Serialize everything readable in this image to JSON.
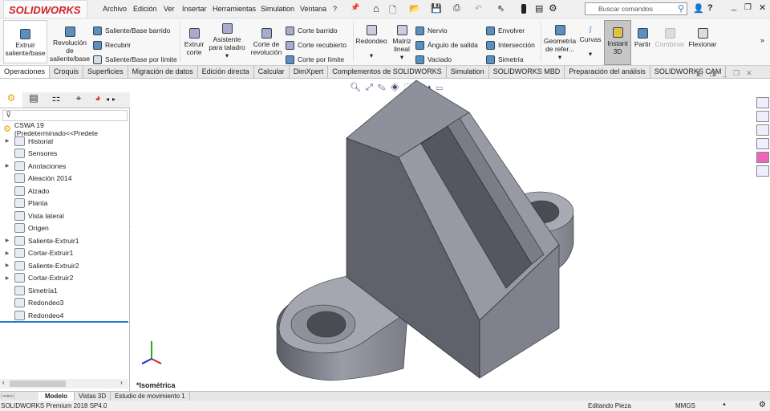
{
  "app": {
    "brand": "SOLIDWORKS"
  },
  "menu": [
    "Archivo",
    "Edición",
    "Ver",
    "Insertar",
    "Herramientas",
    "Simulation",
    "Ventana",
    "?"
  ],
  "search": {
    "placeholder": "Buscar comandos"
  },
  "ribbon": {
    "extrude": "Extruir saliente/base",
    "revolve": "Revolución de saliente/base",
    "sweep": "Saliente/Base barrido",
    "loft": "Recubrir",
    "boundary": "Saliente/Base por límite",
    "cut_extrude": "Extruir corte",
    "hole": "Asistente para taladro",
    "cut_revolve": "Corte de revolución",
    "cut_sweep": "Corte barrido",
    "cut_loft": "Corte recubierto",
    "cut_boundary": "Corte por límite",
    "fillet": "Redondeo",
    "pattern": "Matriz lineal",
    "rib": "Nervio",
    "draft": "Ángulo de salida",
    "shell": "Vaciado",
    "wrap": "Envolver",
    "intersect": "Intersección",
    "mirror": "Simetría",
    "refgeom": "Geometría de refer...",
    "curves": "Curvas",
    "instant3d": "Instant 3D",
    "split": "Partir",
    "combine": "Combinar",
    "flex": "Flexionar"
  },
  "tabs": [
    "Operaciones",
    "Croquis",
    "Superficies",
    "Migración de datos",
    "Edición directa",
    "Calcular",
    "DimXpert",
    "Complementos de SOLIDWORKS",
    "Simulation",
    "SOLIDWORKS MBD",
    "Preparación del análisis",
    "SOLIDWORKS CAM"
  ],
  "tree": {
    "root": "CSWA 19  (Predeterminado<<Predete",
    "items": [
      {
        "label": "Historial",
        "exp": true
      },
      {
        "label": "Sensores",
        "exp": false
      },
      {
        "label": "Anotaciones",
        "exp": true
      },
      {
        "label": "Aleación 2014",
        "exp": false
      },
      {
        "label": "Alzado",
        "exp": false
      },
      {
        "label": "Planta",
        "exp": false
      },
      {
        "label": "Vista lateral",
        "exp": false
      },
      {
        "label": "Origen",
        "exp": false
      },
      {
        "label": "Saliente-Extruir1",
        "exp": true
      },
      {
        "label": "Cortar-Extruir1",
        "exp": true
      },
      {
        "label": "Saliente-Extruir2",
        "exp": true
      },
      {
        "label": "Cortar-Extruir2",
        "exp": true
      },
      {
        "label": "Simetría1",
        "exp": false
      },
      {
        "label": "Redondeo3",
        "exp": false
      },
      {
        "label": "Redondeo4",
        "exp": false
      }
    ]
  },
  "viewport": {
    "view_name": "*Isométrica"
  },
  "bottom_tabs": [
    "Modelo",
    "Vistas 3D",
    "Estudio de movimiento 1"
  ],
  "status": {
    "version": "SOLIDWORKS Premium 2018 SP4.0",
    "mode": "Editando Pieza",
    "units": "MMGS"
  },
  "colors": {
    "brand": "#d21f26",
    "accent": "#1e7fd0"
  }
}
